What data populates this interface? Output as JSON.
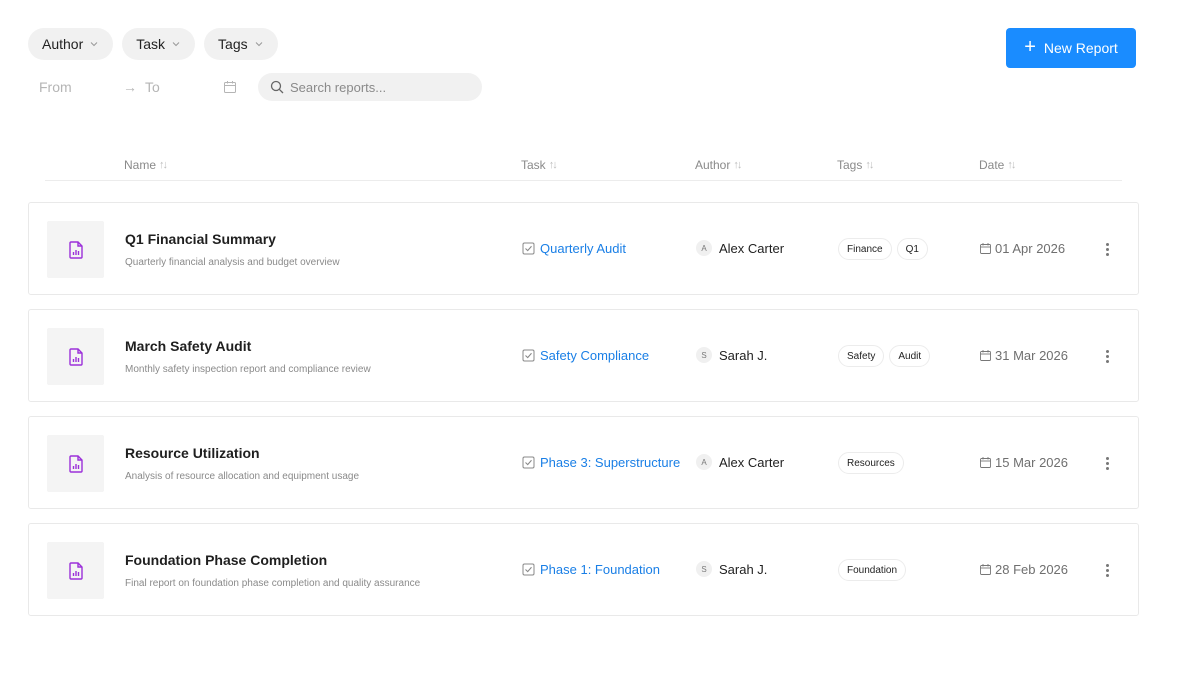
{
  "filters": {
    "author_label": "Author",
    "task_label": "Task",
    "tags_label": "Tags"
  },
  "new_report_label": "New Report",
  "date_range": {
    "from_placeholder": "From",
    "arrow": "→",
    "to_placeholder": "To"
  },
  "search": {
    "placeholder": "Search reports..."
  },
  "columns": {
    "name": "Name",
    "task": "Task",
    "author": "Author",
    "tags": "Tags",
    "date": "Date",
    "sort_glyph": "↑↓"
  },
  "reports": [
    {
      "name": "Q1 Financial Summary",
      "description": "Quarterly financial analysis and budget overview",
      "task": "Quarterly Audit",
      "author_initial": "A",
      "author": "Alex Carter",
      "tags": [
        "Finance",
        "Q1"
      ],
      "date": "01 Apr 2026"
    },
    {
      "name": "March Safety Audit",
      "description": "Monthly safety inspection report and compliance review",
      "task": "Safety Compliance",
      "author_initial": "S",
      "author": "Sarah J.",
      "tags": [
        "Safety",
        "Audit"
      ],
      "date": "31 Mar 2026"
    },
    {
      "name": "Resource Utilization",
      "description": "Analysis of resource allocation and equipment usage",
      "task": "Phase 3: Superstructure",
      "author_initial": "A",
      "author": "Alex Carter",
      "tags": [
        "Resources"
      ],
      "date": "15 Mar 2026"
    },
    {
      "name": "Foundation Phase Completion",
      "description": "Final report on foundation phase completion and quality assurance",
      "task": "Phase 1: Foundation",
      "author_initial": "S",
      "author": "Sarah J.",
      "tags": [
        "Foundation"
      ],
      "date": "28 Feb 2026"
    }
  ],
  "colors": {
    "accent": "#1a8cff",
    "link": "#1a7fe6",
    "report_icon": "#9b30d9"
  },
  "icons": {
    "chevron": "chevron-down-icon",
    "calendar": "calendar-icon",
    "search": "search-icon",
    "report": "report-chart-icon",
    "task": "checkbox-icon",
    "more": "more-vertical-icon"
  }
}
